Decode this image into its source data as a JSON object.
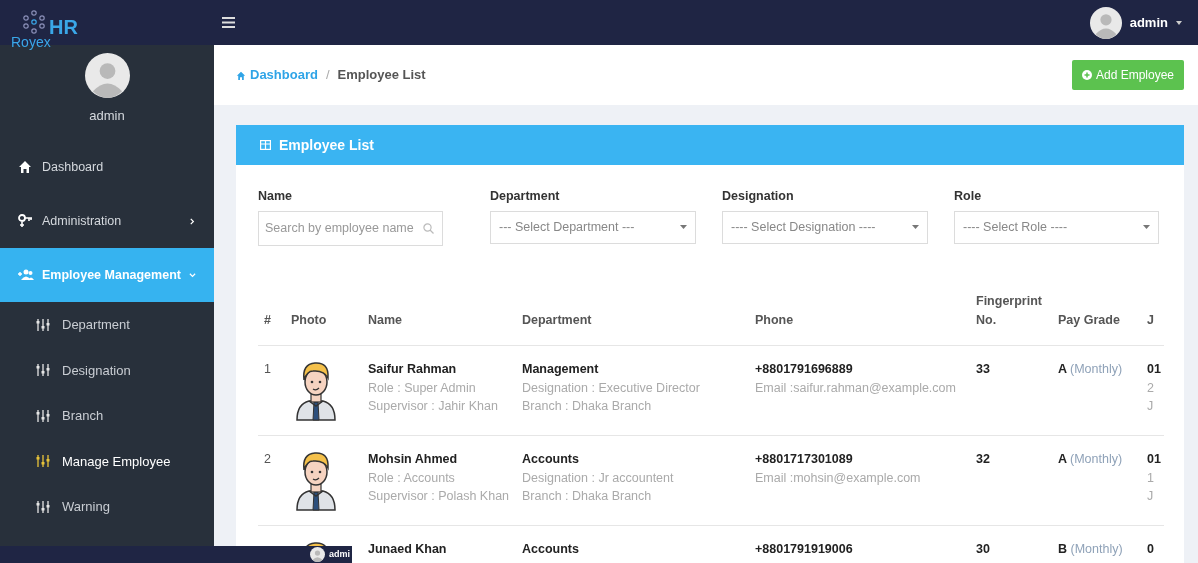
{
  "logo": {
    "mark": "HR",
    "text": "Royex"
  },
  "topbar": {
    "user": "admin"
  },
  "sidebar": {
    "user": "admin",
    "items": [
      {
        "label": "Dashboard",
        "selected": false
      },
      {
        "label": "Administration",
        "selected": false,
        "expanded": false
      },
      {
        "label": "Employee Management",
        "selected": true,
        "expanded": true,
        "children": [
          {
            "label": "Department",
            "selected": false
          },
          {
            "label": "Designation",
            "selected": false
          },
          {
            "label": "Branch",
            "selected": false
          },
          {
            "label": "Manage Employee",
            "selected": true
          },
          {
            "label": "Warning",
            "selected": false
          }
        ]
      }
    ]
  },
  "breadcrumb_separator": "/",
  "breadcrumb": [
    {
      "label": "Dashboard",
      "kind": "link"
    },
    {
      "label": "Employee List",
      "kind": "current"
    }
  ],
  "add_button": "Add Employee",
  "card": {
    "title": "Employee List",
    "filters": [
      {
        "label": "Name",
        "kind": "search",
        "placeholder": "Search by employee name"
      },
      {
        "label": "Department",
        "kind": "select",
        "value": "--- Select Department ---"
      },
      {
        "label": "Designation",
        "kind": "select",
        "value": "---- Select Designation ----"
      },
      {
        "label": "Role",
        "kind": "select",
        "value": "---- Select Role ----"
      }
    ],
    "table": {
      "columns": [
        "#",
        "Photo",
        "Name",
        "Department",
        "Phone",
        "Fingerprint No.",
        "Pay Grade",
        "J"
      ],
      "rows": [
        {
          "index": "1",
          "name": "Saifur Rahman",
          "role": "Role : Super Admin",
          "supervisor": "Supervisor : Jahir Khan",
          "department": "Management",
          "designation": "Designation : Executive Director",
          "branch": "Branch : Dhaka Branch",
          "phone": "+8801791696889",
          "email": "Email :saifur.rahman@example.com",
          "fingerprint": "33",
          "pay_grade": "A",
          "pay_type": "(Monthly)",
          "column_8": [
            "01",
            "2",
            "J"
          ]
        },
        {
          "index": "2",
          "name": "Mohsin Ahmed",
          "role": "Role : Accounts",
          "supervisor": "Supervisor : Polash Khan",
          "department": "Accounts",
          "designation": "Designation : Jr accountent",
          "branch": "Branch : Dhaka Branch",
          "phone": "+8801717301089",
          "email": "Email :mohsin@example.com",
          "fingerprint": "32",
          "pay_grade": "A",
          "pay_type": "(Monthly)",
          "column_8": [
            "01",
            "1",
            "J"
          ]
        },
        {
          "name": "Junaed Khan",
          "department": "Accounts",
          "phone": "+8801791919006",
          "fingerprint": "30",
          "pay_grade": "B",
          "pay_type": "(Monthly)",
          "column_8": [
            "0"
          ]
        }
      ]
    }
  },
  "bottom_bar": {
    "user": "admi"
  }
}
